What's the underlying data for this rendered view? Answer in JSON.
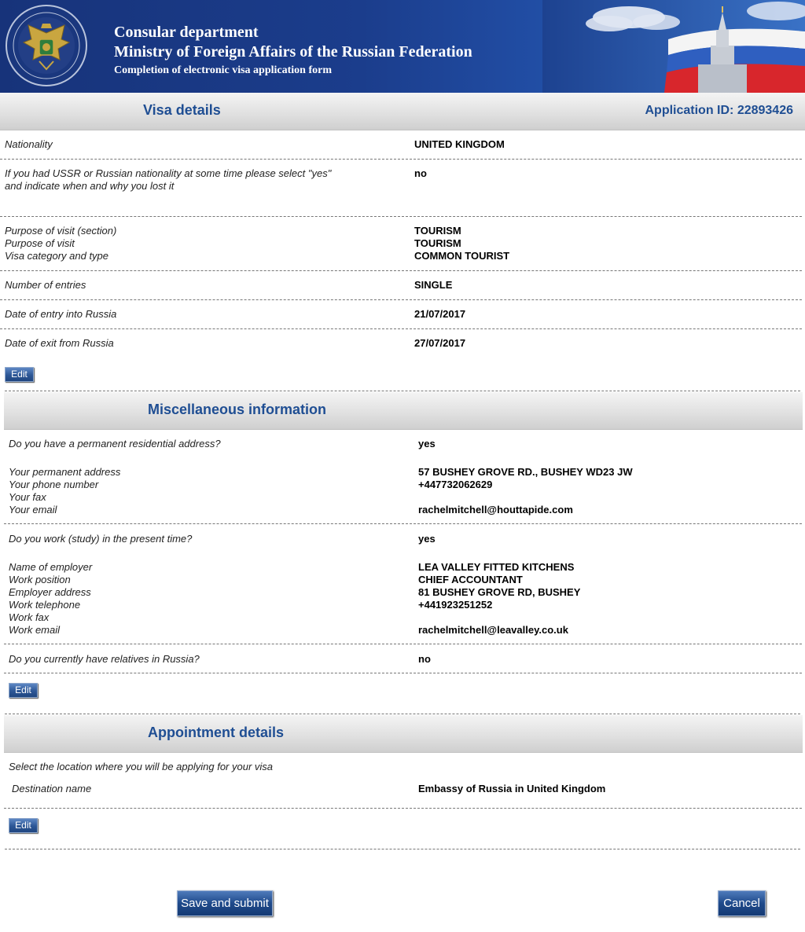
{
  "header": {
    "line1": "Consular department",
    "line2": "Ministry of Foreign Affairs of the Russian Federation",
    "line3": "Completion of electronic visa application form",
    "accent_color": "#1b3d8c"
  },
  "visa_details": {
    "title": "Visa details",
    "application_id": "Application ID: 22893426",
    "nationality_label": "Nationality",
    "nationality_value": "UNITED KINGDOM",
    "ussr_label_1": "If you had USSR or Russian nationality at some time please select \"yes\"",
    "ussr_label_2": "and indicate when and why you lost it",
    "ussr_value": "no",
    "purpose_section_label": "Purpose of visit (section)",
    "purpose_section_value": "TOURISM",
    "purpose_label": "Purpose of visit",
    "purpose_value": "TOURISM",
    "category_label": "Visa category and type",
    "category_value": "COMMON TOURIST",
    "entries_label": "Number of entries",
    "entries_value": "SINGLE",
    "entry_date_label": "Date of entry into Russia",
    "entry_date_value": "21/07/2017",
    "exit_date_label": "Date of exit from Russia",
    "exit_date_value": "27/07/2017",
    "edit_label": "Edit"
  },
  "misc": {
    "title": "Miscellaneous information",
    "perm_addr_q": "Do you have a permanent residential address?",
    "perm_addr_a": "yes",
    "address_label": "Your permanent address",
    "address_value": "57 BUSHEY GROVE RD., BUSHEY WD23 JW",
    "phone_label": "Your phone number",
    "phone_value": "+447732062629",
    "fax_label": "Your fax",
    "fax_value": "",
    "email_label": "Your email",
    "email_value": "rachelmitchell@houttapide.com",
    "work_q": "Do you work (study) in the present time?",
    "work_a": "yes",
    "employer_label": "Name of employer",
    "employer_value": "LEA VALLEY FITTED KITCHENS",
    "position_label": "Work position",
    "position_value": "CHIEF ACCOUNTANT",
    "emp_addr_label": "Employer address",
    "emp_addr_value": "81 BUSHEY GROVE RD, BUSHEY",
    "work_tel_label": "Work telephone",
    "work_tel_value": "+441923251252",
    "work_fax_label": "Work fax",
    "work_fax_value": "",
    "work_email_label": "Work email",
    "work_email_value": "rachelmitchell@leavalley.co.uk",
    "relatives_q": "Do you currently have relatives in Russia?",
    "relatives_a": "no",
    "edit_label": "Edit"
  },
  "appointment": {
    "title": "Appointment details",
    "instruction": "Select the location where you will be applying for your visa",
    "destination_label": "Destination name",
    "destination_value": "Embassy of Russia in United Kingdom",
    "edit_label": "Edit"
  },
  "actions": {
    "save_label": "Save and submit",
    "cancel_label": "Cancel"
  }
}
